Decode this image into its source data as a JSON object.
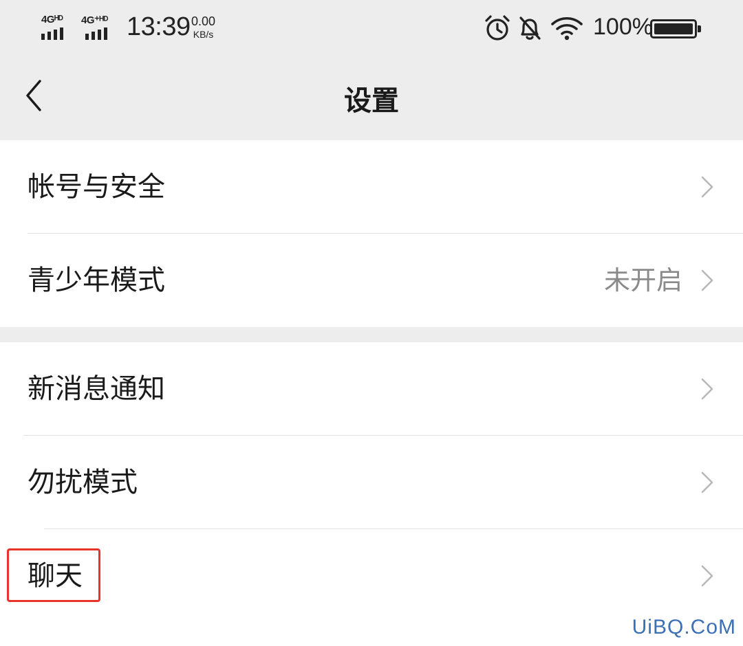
{
  "status_bar": {
    "sim1_network": "4Gᴴᴰ",
    "sim2_network": "4G⁺ᴴᴰ",
    "time": "13:39",
    "net_speed_value": "0.00",
    "net_speed_unit": "KB/s",
    "icons": [
      "alarm-icon",
      "mute-bell-icon",
      "wifi-icon",
      "battery-icon"
    ],
    "battery_percent": "100%"
  },
  "nav": {
    "back_icon": "chevron-left-icon",
    "title": "设置"
  },
  "settings": {
    "group1": [
      {
        "label": "帐号与安全",
        "value": ""
      },
      {
        "label": "青少年模式",
        "value": "未开启"
      }
    ],
    "group2": [
      {
        "label": "新消息通知",
        "value": ""
      },
      {
        "label": "勿扰模式",
        "value": ""
      },
      {
        "label": "聊天",
        "value": "",
        "highlighted": true
      }
    ]
  },
  "watermark": "UiBQ.CoM",
  "colors": {
    "background": "#ededed",
    "card": "#ffffff",
    "text": "#1a1a1a",
    "secondary_text": "#8a8a8a",
    "chevron": "#b8b8b8",
    "highlight": "#e8322c",
    "watermark": "#3b6fb6"
  }
}
